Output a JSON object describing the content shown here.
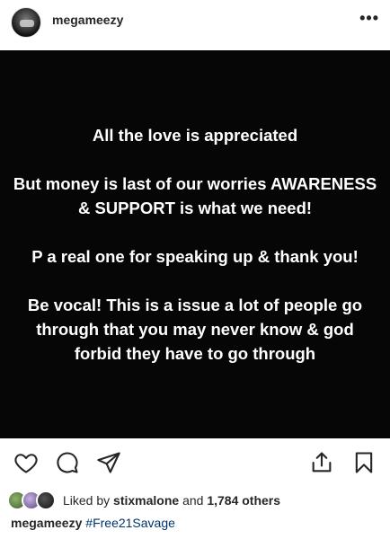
{
  "header": {
    "username": "megameezy",
    "more_label": "•••"
  },
  "post": {
    "paragraphs": [
      "All the love is appreciated",
      "But money is last of our worries AWARENESS & SUPPORT is what we need!",
      "P a real one for speaking up & thank you!",
      "Be vocal! This is a issue a lot of people go through that you may never know & god forbid they have to go through"
    ]
  },
  "actions": {
    "icons": [
      "heart-icon",
      "comment-icon",
      "share-icon",
      "upload-icon",
      "bookmark-icon"
    ]
  },
  "likes": {
    "prefix": "Liked by",
    "user": "stixmalone",
    "connector": "and",
    "count": "1,784 others"
  },
  "caption": {
    "username": "megameezy",
    "hashtag": "#Free21Savage"
  },
  "colors": {
    "post_background": "#060606",
    "post_text": "#ffffff",
    "hashtag": "#003569"
  }
}
